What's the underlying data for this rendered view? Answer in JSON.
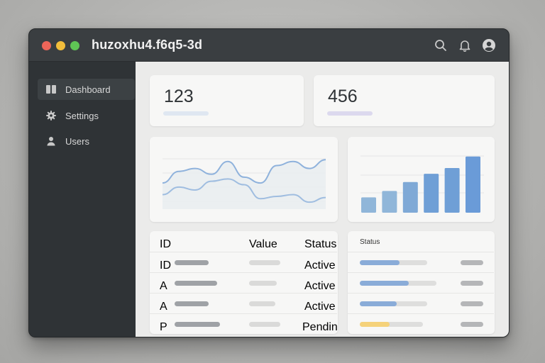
{
  "window": {
    "title": "huzoxhu4.f6q5-3d"
  },
  "toolbar": {
    "icons": [
      "search-icon",
      "bell-icon",
      "user-avatar-icon"
    ]
  },
  "sidebar": {
    "items": [
      {
        "label": "Dashboard",
        "icon": "dashboard-icon",
        "active": true
      },
      {
        "label": "Settings",
        "icon": "gear-icon",
        "active": false
      },
      {
        "label": "Users",
        "icon": "user-icon",
        "active": false
      }
    ]
  },
  "stats": [
    {
      "value": "123",
      "accent": "#dfe7f1"
    },
    {
      "value": "456",
      "accent": "#dcd9ee"
    }
  ],
  "chart_data": [
    {
      "type": "line",
      "series": [
        {
          "values": [
            45,
            65,
            70,
            60,
            82,
            55,
            45,
            75,
            82,
            70,
            85
          ]
        },
        {
          "values": [
            25,
            38,
            33,
            48,
            52,
            42,
            18,
            22,
            25,
            12,
            20
          ]
        }
      ]
    },
    {
      "type": "bar",
      "values": [
        24,
        34,
        48,
        61,
        70,
        88
      ],
      "colors": [
        "#90b6d9",
        "#90b6d9",
        "#7fa9d6",
        "#6f9fd6",
        "#6f9fd6",
        "#6a9bd8"
      ]
    }
  ],
  "table": {
    "headers": {
      "id": "ID",
      "value": "Value",
      "status": "Status"
    },
    "rows": [
      {
        "id": "ID",
        "status": "Active"
      },
      {
        "id": "A",
        "status": "Active"
      },
      {
        "id": "A",
        "status": "Active"
      },
      {
        "id": "P",
        "status": "Pending"
      }
    ]
  },
  "status_panel": {
    "header": "Status",
    "progress": [
      {
        "fill": 0.59,
        "color": "#8aacd8"
      },
      {
        "fill": 0.64,
        "color": "#8aacd8"
      },
      {
        "fill": 0.55,
        "color": "#8aacd8"
      },
      {
        "fill": 0.47,
        "color": "#f5d27a"
      }
    ]
  }
}
